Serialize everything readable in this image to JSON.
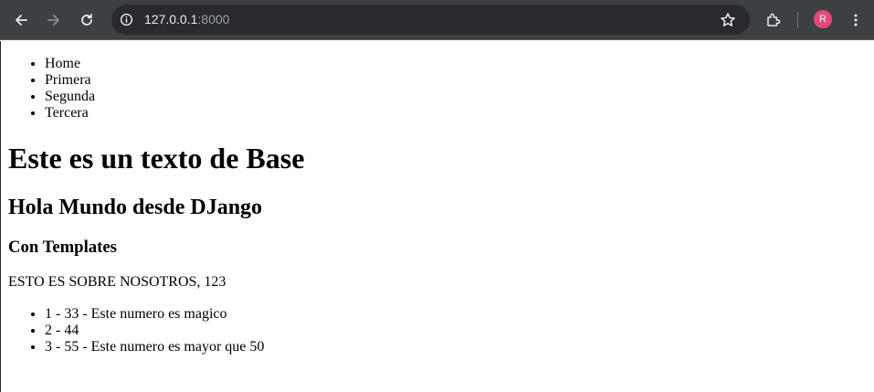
{
  "browser": {
    "url_host": "127.0.0.1",
    "url_port": ":8000",
    "profile_initial": "R",
    "icons": [
      "back-arrow-icon",
      "forward-arrow-icon",
      "reload-icon",
      "info-icon",
      "star-icon",
      "extensions-icon",
      "more-vert-icon"
    ],
    "colors": {
      "toolbar": "#3c4043",
      "omnibox": "#282a2d",
      "avatar": "#e8457a"
    }
  },
  "page": {
    "nav": [
      "Home",
      "Primera",
      "Segunda",
      "Tercera"
    ],
    "title": "Este es un texto de Base",
    "subtitle": "Hola Mundo desde DJango",
    "section": "Con Templates",
    "about": "ESTO ES SOBRE NOSOTROS, 123",
    "numbers": [
      "1 - 33 - Este numero es magico",
      "2 - 44",
      "3 - 55 - Este numero es mayor que 50"
    ]
  }
}
